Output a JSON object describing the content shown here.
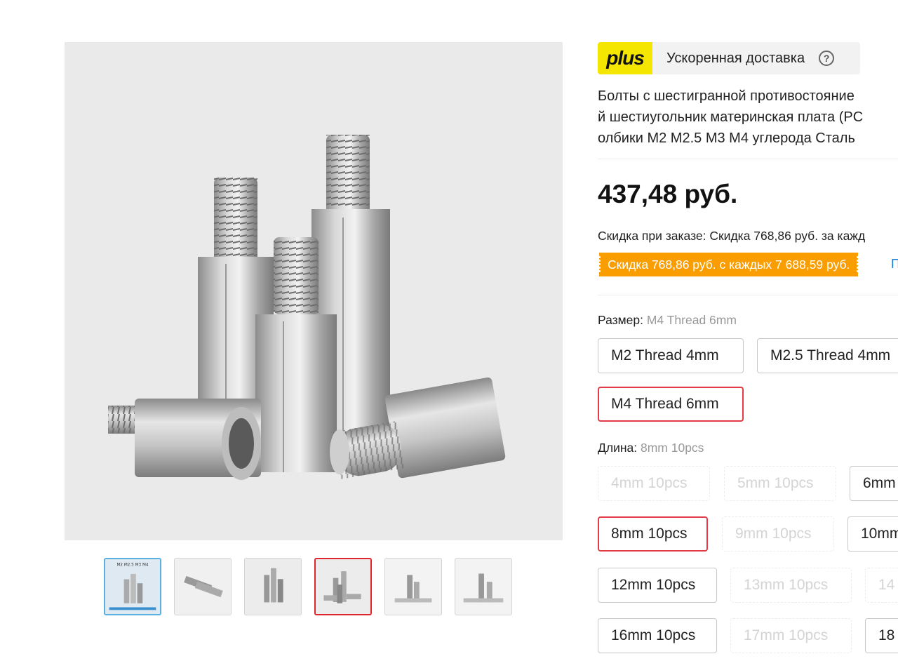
{
  "gallery": {
    "thumbnails": [
      {
        "name": "thumbnail-1",
        "active": false,
        "caption": "M2 M2.5 M3 M4"
      },
      {
        "name": "thumbnail-2",
        "active": false
      },
      {
        "name": "thumbnail-3",
        "active": false
      },
      {
        "name": "thumbnail-4",
        "active": true
      },
      {
        "name": "thumbnail-5",
        "active": false
      },
      {
        "name": "thumbnail-6",
        "active": false
      }
    ]
  },
  "delivery": {
    "badge": "plus",
    "text": "Ускоренная доставка",
    "help_icon": "?",
    "colors": {
      "badge_bg": "#f5e600"
    }
  },
  "product": {
    "title_lines": [
      "Болты с шестигранной противостояние",
      "й шестиугольник материнская плата (PC",
      "олбики M2 M2.5 M3 M4 углерода Сталь"
    ],
    "price": "437,48 руб.",
    "discount_line": "Скидка при заказе: Скидка 768,86 руб. за кажд",
    "coupon": "Скидка 768,86 руб. с каждых 7 688,59 руб.",
    "coupon_link": "П",
    "colors": {
      "coupon_bg": "#f99d00",
      "selected_border": "#e33b45",
      "link": "#1a7fd4"
    }
  },
  "size": {
    "label": "Размер:",
    "selected": "M4 Thread 6mm",
    "options": [
      {
        "label": "M2 Thread 4mm",
        "state": "normal"
      },
      {
        "label": "M2.5 Thread 4mm",
        "state": "normal"
      },
      {
        "label": "M4 Thread 6mm",
        "state": "selected"
      }
    ]
  },
  "length": {
    "label": "Длина:",
    "selected": "8mm 10pcs",
    "options": [
      {
        "label": "4mm 10pcs",
        "state": "disabled"
      },
      {
        "label": "5mm 10pcs",
        "state": "disabled"
      },
      {
        "label": "6mm",
        "state": "normal"
      },
      {
        "label": "8mm 10pcs",
        "state": "selected"
      },
      {
        "label": "9mm 10pcs",
        "state": "disabled"
      },
      {
        "label": "10mm",
        "state": "normal"
      },
      {
        "label": "12mm 10pcs",
        "state": "normal"
      },
      {
        "label": "13mm 10pcs",
        "state": "disabled"
      },
      {
        "label": "14",
        "state": "disabled"
      },
      {
        "label": "16mm 10pcs",
        "state": "normal"
      },
      {
        "label": "17mm 10pcs",
        "state": "disabled"
      },
      {
        "label": "18",
        "state": "normal"
      }
    ]
  }
}
